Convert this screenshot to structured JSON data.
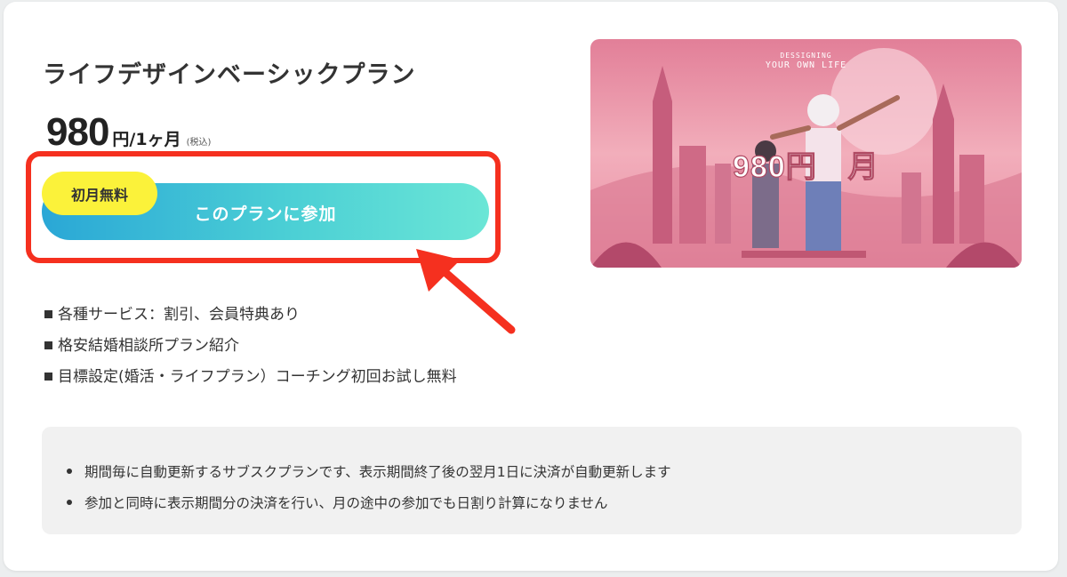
{
  "plan": {
    "title": "ライフデザインベーシックプラン",
    "price": "980",
    "unit": "円/1ヶ月",
    "tax_note": "(税込)"
  },
  "cta": {
    "badge": "初月無料",
    "label": "このプランに参加"
  },
  "features": [
    "各種サービス：割引、会員特典あり",
    "格安結婚相談所プラン紹介",
    "目標設定(婚活・ライフプラン）コーチング初回お試し無料"
  ],
  "hero": {
    "line1": "DESSIGNING",
    "line2": "YOUR OWN LIFE",
    "price_text": "980円　月"
  },
  "notes": [
    "期間毎に自動更新するサブスクプランです、表示期間終了後の翌月1日に決済が自動更新します",
    "参加と同時に表示期間分の決済を行い、月の途中の参加でも日割り計算になりません"
  ],
  "colors": {
    "highlight": "#f5301f",
    "badge": "#fbf23a",
    "button_start": "#2aa7d6",
    "button_end": "#6be6d6"
  }
}
